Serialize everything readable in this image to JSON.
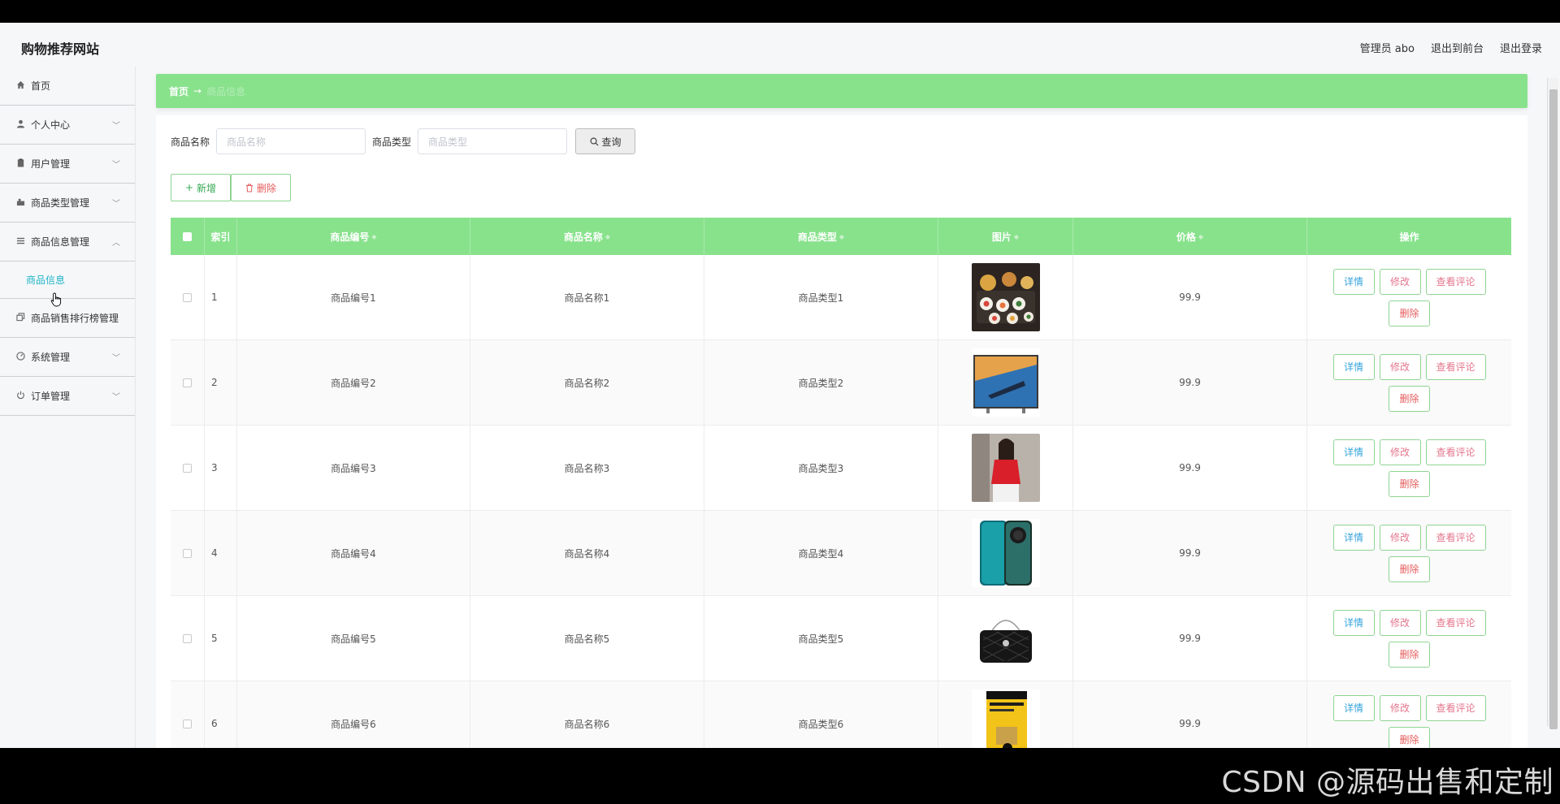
{
  "header": {
    "site_title": "购物推荐网站",
    "admin_label": "管理员 abo",
    "to_front": "退出到前台",
    "logout": "退出登录"
  },
  "sidebar": {
    "items": [
      {
        "label": "首页",
        "icon": "home-icon"
      },
      {
        "label": "个人中心",
        "icon": "user-icon"
      },
      {
        "label": "用户管理",
        "icon": "clipboard-icon"
      },
      {
        "label": "商品类型管理",
        "icon": "toolbox-icon"
      },
      {
        "label": "商品信息管理",
        "icon": "list-icon"
      },
      {
        "label": "商品销售排行榜管理",
        "icon": "copy-icon"
      },
      {
        "label": "系统管理",
        "icon": "gauge-icon"
      },
      {
        "label": "订单管理",
        "icon": "power-icon"
      }
    ],
    "active_sub": "商品信息"
  },
  "breadcrumb": {
    "home": "首页",
    "arrow": "→",
    "current": "商品信息"
  },
  "search": {
    "name_label": "商品名称",
    "name_placeholder": "商品名称",
    "type_label": "商品类型",
    "type_placeholder": "商品类型",
    "query_button": "查询"
  },
  "actions": {
    "add": "新增",
    "delete": "删除"
  },
  "table": {
    "headers": {
      "index": "索引",
      "code": "商品编号",
      "name": "商品名称",
      "type": "商品类型",
      "image": "图片",
      "price": "价格",
      "ops": "操作"
    },
    "row_buttons": {
      "detail": "详情",
      "edit": "修改",
      "review": "查看评论",
      "remove": "删除"
    },
    "rows": [
      {
        "index": "1",
        "code": "商品编号1",
        "name": "商品名称1",
        "type": "商品类型1",
        "price": "99.9",
        "image": "sushi-photo"
      },
      {
        "index": "2",
        "code": "商品编号2",
        "name": "商品名称2",
        "type": "商品类型2",
        "price": "99.9",
        "image": "television-photo"
      },
      {
        "index": "3",
        "code": "商品编号3",
        "name": "商品名称3",
        "type": "商品类型3",
        "price": "99.9",
        "image": "red-top-photo"
      },
      {
        "index": "4",
        "code": "商品编号4",
        "name": "商品名称4",
        "type": "商品类型4",
        "price": "99.9",
        "image": "smartphone-photo"
      },
      {
        "index": "5",
        "code": "商品编号5",
        "name": "商品名称5",
        "type": "商品类型5",
        "price": "99.9",
        "image": "handbag-photo"
      },
      {
        "index": "6",
        "code": "商品编号6",
        "name": "商品名称6",
        "type": "商品类型6",
        "price": "99.9",
        "image": "book-photo"
      }
    ]
  },
  "watermark": "CSDN @源码出售和定制",
  "colors": {
    "accent_green": "#88e28c",
    "active_link": "#1eb5c7",
    "danger": "#e65c5c"
  }
}
